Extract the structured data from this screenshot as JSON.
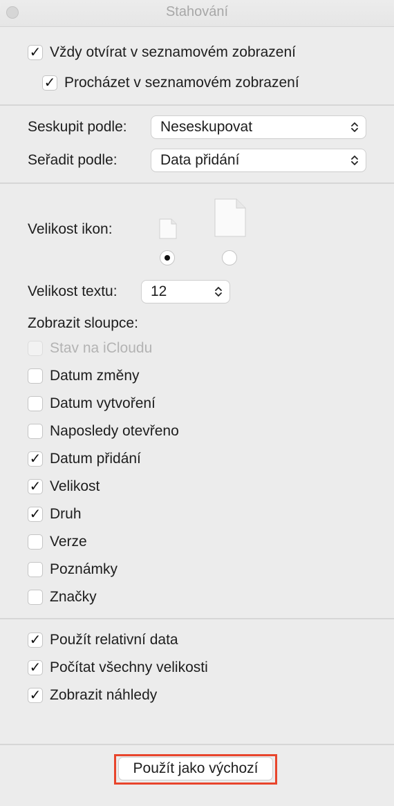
{
  "window": {
    "title": "Stahování"
  },
  "browse": {
    "always_open_list": {
      "label": "Vždy otvírat v seznamovém zobrazení",
      "checked": true
    },
    "browse_list": {
      "label": "Procházet v seznamovém zobrazení",
      "checked": true
    }
  },
  "grouping": {
    "group_by_label": "Seskupit podle:",
    "group_by_value": "Neseskupovat",
    "sort_by_label": "Seřadit podle:",
    "sort_by_value": "Data přidání"
  },
  "icon_size": {
    "label": "Velikost ikon:",
    "selected": "small"
  },
  "text_size": {
    "label": "Velikost textu:",
    "value": "12"
  },
  "columns": {
    "heading": "Zobrazit sloupce:",
    "items": [
      {
        "label": "Stav na iCloudu",
        "checked": false,
        "disabled": true
      },
      {
        "label": "Datum změny",
        "checked": false,
        "disabled": false
      },
      {
        "label": "Datum vytvoření",
        "checked": false,
        "disabled": false
      },
      {
        "label": "Naposledy otevřeno",
        "checked": false,
        "disabled": false
      },
      {
        "label": "Datum přidání",
        "checked": true,
        "disabled": false
      },
      {
        "label": "Velikost",
        "checked": true,
        "disabled": false
      },
      {
        "label": "Druh",
        "checked": true,
        "disabled": false
      },
      {
        "label": "Verze",
        "checked": false,
        "disabled": false
      },
      {
        "label": "Poznámky",
        "checked": false,
        "disabled": false
      },
      {
        "label": "Značky",
        "checked": false,
        "disabled": false
      }
    ]
  },
  "options": {
    "items": [
      {
        "label": "Použít relativní data",
        "checked": true
      },
      {
        "label": "Počítat všechny velikosti",
        "checked": true
      },
      {
        "label": "Zobrazit náhledy",
        "checked": true
      }
    ]
  },
  "footer": {
    "use_as_default": "Použít jako výchozí"
  },
  "colors": {
    "highlight": "#e8452c",
    "background": "#ececec"
  }
}
